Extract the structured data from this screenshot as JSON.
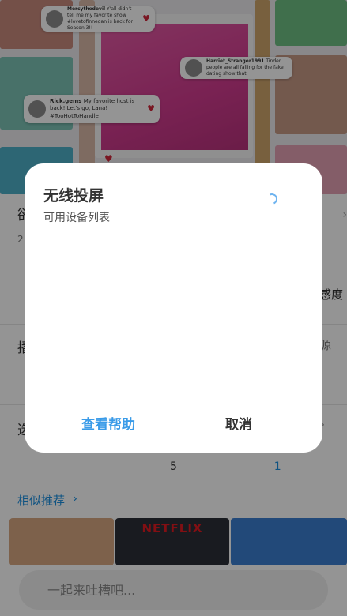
{
  "hero": {
    "comments": [
      {
        "user": "Mercythedevil",
        "text": "Y'all didn't tell me my favorite show #lovetofinnegan is back for Season 3!!"
      },
      {
        "user": "Harriet_Stranger1991",
        "text": "Tinder people are all falling for the fake dating show that"
      },
      {
        "user": "Rick.gems",
        "text": "My favorite host is back! Let's go, Lana! #TooHotToHandle"
      }
    ]
  },
  "details": {
    "title_partial": "欲",
    "meta_partial": "2",
    "row1_right": "感度",
    "row2_left": "播",
    "row2_right": "源",
    "row3_left": "选"
  },
  "episodes": [
    "5",
    "1"
  ],
  "similar": {
    "title": "相似推荐",
    "poster_brand": "NETFLIX"
  },
  "comment_bar": {
    "placeholder": "一起来吐槽吧..."
  },
  "dialog": {
    "title": "无线投屏",
    "subtitle": "可用设备列表",
    "help_label": "查看帮助",
    "cancel_label": "取消"
  }
}
